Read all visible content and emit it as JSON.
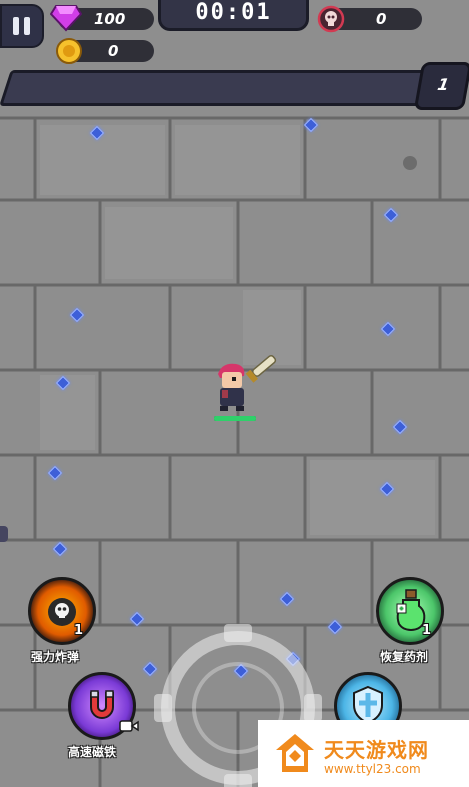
{
  "hud": {
    "gems": "100",
    "coins": "0",
    "timer": "00:01",
    "kills": "0",
    "level": "1",
    "xp_progress": 0
  },
  "skills": {
    "bomb": {
      "label": "强力炸弹",
      "count": "1",
      "icon": "skull-bomb-icon"
    },
    "potion": {
      "label": "恢复药剂",
      "count": "1",
      "icon": "potion-icon"
    },
    "magnet": {
      "label": "高速磁铁",
      "icon": "magnet-icon",
      "badge": "video-icon"
    },
    "shield": {
      "icon": "shield-cross-icon"
    }
  },
  "watermark": {
    "name": "天天游戏网",
    "url": "www.ttyl23.com"
  },
  "colors": {
    "xp_bar": "#3a3b50",
    "hp_bar": "#2fd06a",
    "gem": "#3d5fd8",
    "watermark_orange": "#f08a1c"
  }
}
